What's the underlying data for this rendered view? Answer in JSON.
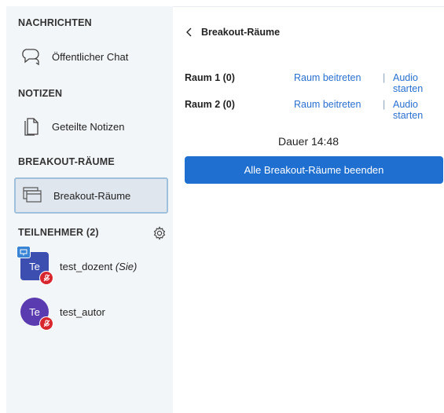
{
  "sidebar": {
    "sections": {
      "messages": "NACHRICHTEN",
      "notes": "NOTIZEN",
      "breakout": "BREAKOUT-RÄUME",
      "participants": "TEILNEHMER (2)"
    },
    "items": {
      "public_chat": "Öffentlicher Chat",
      "shared_notes": "Geteilte Notizen",
      "breakout_rooms": "Breakout-Räume"
    },
    "users": [
      {
        "initials": "Te",
        "name": "test_dozent",
        "suffix": "(Sie)"
      },
      {
        "initials": "Te",
        "name": "test_autor",
        "suffix": ""
      }
    ]
  },
  "main": {
    "back_label": "Breakout-Räume",
    "rooms": [
      {
        "name": "Raum 1 (0)",
        "join": "Raum beitreten",
        "sep": "|",
        "audio": "Audio starten"
      },
      {
        "name": "Raum 2 (0)",
        "join": "Raum beitreten",
        "sep": "|",
        "audio": "Audio starten"
      }
    ],
    "duration": "Dauer 14:48",
    "end_button": "Alle Breakout-Räume beenden"
  },
  "colors": {
    "accent": "#1f6fd0",
    "link": "#2a6fcf",
    "sidebar_bg": "#f3f6f9",
    "mute": "#d8262e"
  }
}
